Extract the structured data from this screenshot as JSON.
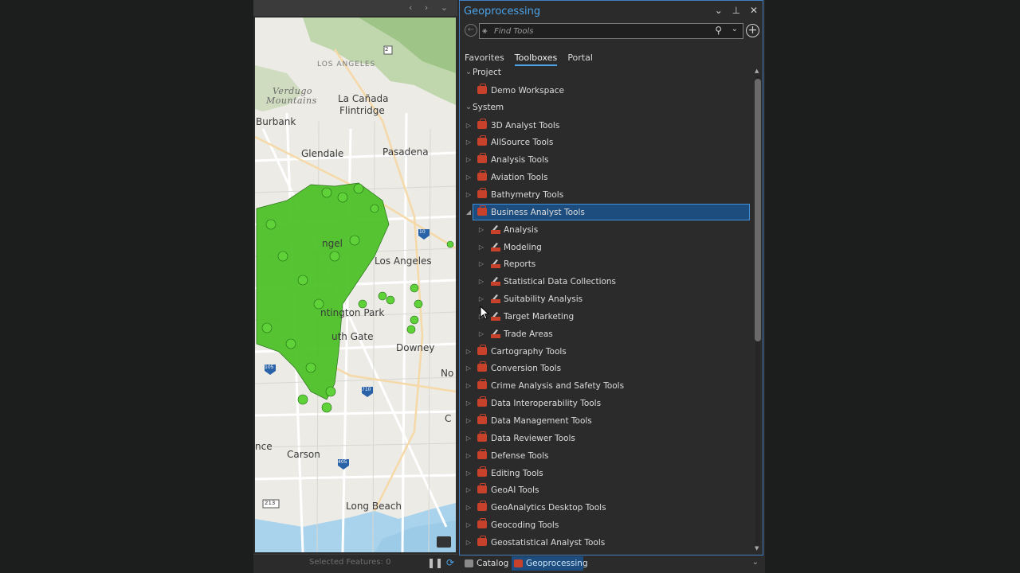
{
  "window": {
    "nav_arrows": "‹ › ⌄"
  },
  "map": {
    "labels": {
      "los_angeles_nf": "LOS ANGELES",
      "verdugo": "Verdugo",
      "mountains": "Mountains",
      "la_canada": "La Cañada",
      "flintridge": "Flintridge",
      "burbank": "Burbank",
      "glendale": "Glendale",
      "pasadena": "Pasadena",
      "los_angeles": "Los Angeles",
      "angel": "ngel",
      "huntington_park": "ntington Park",
      "south_gate": "uth Gate",
      "downey": "Downey",
      "norwalk": "No",
      "cerritos": "C",
      "carson": "Carson",
      "long_beach": "Long Beach",
      "lawndale": "nce"
    },
    "shields": {
      "r2": "2",
      "i10": "10",
      "i710": "710",
      "i105": "105",
      "i405": "405",
      "r213": "213"
    }
  },
  "statusbar": {
    "selected_features": "Selected Features: 0"
  },
  "gp": {
    "title": "Geoprocessing",
    "search_placeholder": "Find Tools",
    "tabs": [
      "Favorites",
      "Toolboxes",
      "Portal"
    ],
    "active_tab": "Toolboxes",
    "tree": [
      {
        "label": "Project",
        "level": 0,
        "type": "group",
        "expanded": true
      },
      {
        "label": "Demo Workspace",
        "level": 1,
        "type": "toolbox",
        "leaf": true
      },
      {
        "label": "System",
        "level": 0,
        "type": "group",
        "expanded": true
      },
      {
        "label": "3D Analyst Tools",
        "level": 1,
        "type": "toolbox"
      },
      {
        "label": "AllSource Tools",
        "level": 1,
        "type": "toolbox"
      },
      {
        "label": "Analysis Tools",
        "level": 1,
        "type": "toolbox"
      },
      {
        "label": "Aviation Tools",
        "level": 1,
        "type": "toolbox"
      },
      {
        "label": "Bathymetry Tools",
        "level": 1,
        "type": "toolbox"
      },
      {
        "label": "Business Analyst Tools",
        "level": 1,
        "type": "toolbox",
        "expanded": true,
        "selected": true
      },
      {
        "label": "Analysis",
        "level": 2,
        "type": "toolset"
      },
      {
        "label": "Modeling",
        "level": 2,
        "type": "toolset"
      },
      {
        "label": "Reports",
        "level": 2,
        "type": "toolset"
      },
      {
        "label": "Statistical Data Collections",
        "level": 2,
        "type": "toolset"
      },
      {
        "label": "Suitability Analysis",
        "level": 2,
        "type": "toolset"
      },
      {
        "label": "Target Marketing",
        "level": 2,
        "type": "toolset"
      },
      {
        "label": "Trade Areas",
        "level": 2,
        "type": "toolset"
      },
      {
        "label": "Cartography Tools",
        "level": 1,
        "type": "toolbox"
      },
      {
        "label": "Conversion Tools",
        "level": 1,
        "type": "toolbox"
      },
      {
        "label": "Crime Analysis and Safety Tools",
        "level": 1,
        "type": "toolbox"
      },
      {
        "label": "Data Interoperability Tools",
        "level": 1,
        "type": "toolbox"
      },
      {
        "label": "Data Management Tools",
        "level": 1,
        "type": "toolbox"
      },
      {
        "label": "Data Reviewer Tools",
        "level": 1,
        "type": "toolbox"
      },
      {
        "label": "Defense Tools",
        "level": 1,
        "type": "toolbox"
      },
      {
        "label": "Editing Tools",
        "level": 1,
        "type": "toolbox"
      },
      {
        "label": "GeoAI Tools",
        "level": 1,
        "type": "toolbox"
      },
      {
        "label": "GeoAnalytics Desktop Tools",
        "level": 1,
        "type": "toolbox"
      },
      {
        "label": "Geocoding Tools",
        "level": 1,
        "type": "toolbox"
      },
      {
        "label": "Geostatistical Analyst Tools",
        "level": 1,
        "type": "toolbox"
      }
    ]
  },
  "bottom_tabs": [
    "Catalog",
    "Geoprocessing"
  ],
  "colors": {
    "accent": "#4ca3e8",
    "selection": "#1c4d7e",
    "toolbox_icon": "#c8412a",
    "points": "#4fc12a"
  }
}
